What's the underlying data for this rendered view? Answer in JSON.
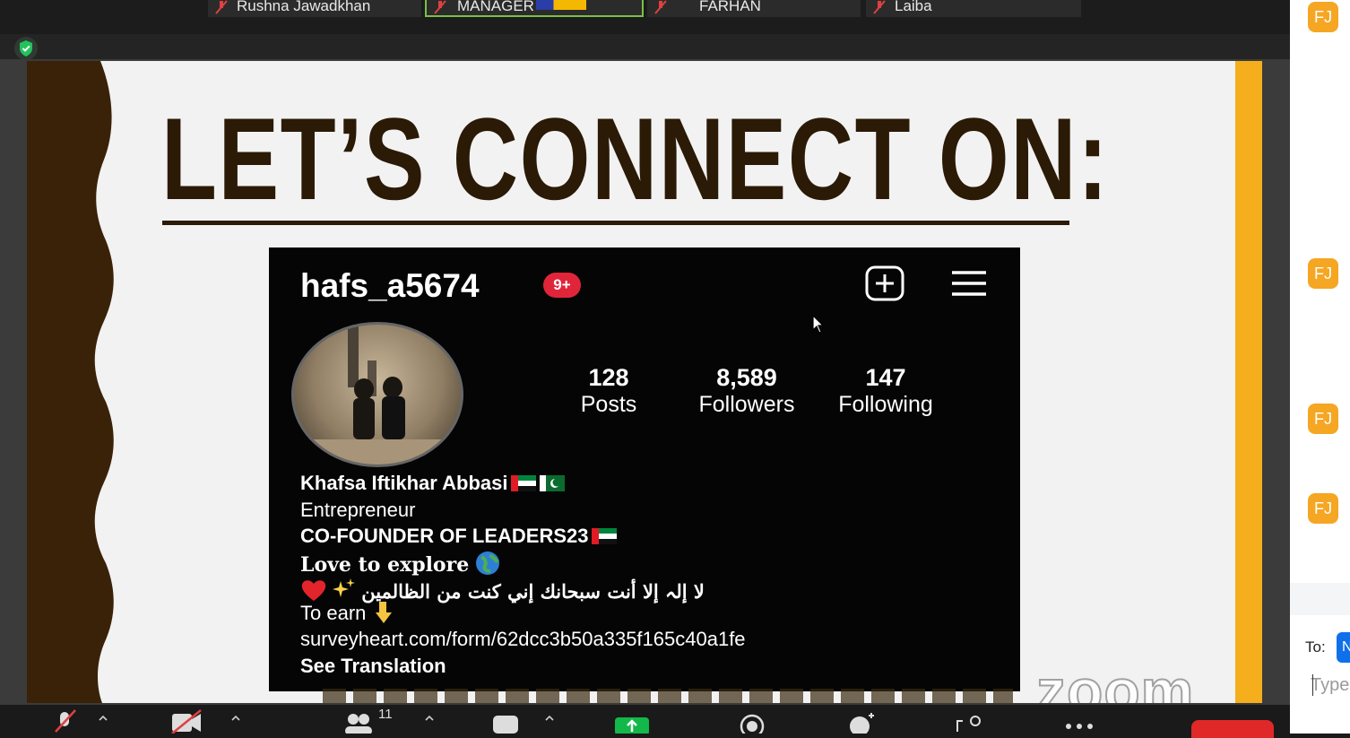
{
  "participants": [
    {
      "name": "Rushna Jawadkhan",
      "muted": true
    },
    {
      "name": "MANAGER",
      "muted": true,
      "active_speaker": true
    },
    {
      "name": "FARHAN",
      "muted": true
    },
    {
      "name": "Laiba",
      "muted": true
    }
  ],
  "slide": {
    "heading": "LET’S CONNECT ON:",
    "watermark": "zoom",
    "instagram": {
      "username": "hafs_a5674",
      "notifications": "9+",
      "stats": [
        {
          "value": "128",
          "label": "Posts"
        },
        {
          "value": "8,589",
          "label": "Followers"
        },
        {
          "value": "147",
          "label": "Following"
        }
      ],
      "bio": {
        "name": "Khafsa Iftikhar Abbasi",
        "role": "Entrepreneur",
        "line3": "CO-FOUNDER OF LEADERS23",
        "line4": "Love to explore",
        "arabic": "لا إلہ إلا أنت سبحانك إني كنت من الظالمين",
        "line6": "To earn",
        "link": "surveyheart.com/form/62dcc3b50a335f165c40a1fe",
        "translate": "See Translation"
      }
    }
  },
  "chat": {
    "avatars": [
      "FJ",
      "FJ",
      "FJ",
      "FJ"
    ],
    "to_label": "To:",
    "to_chip": "N",
    "input_placeholder": "Type"
  },
  "toolbar": {
    "participants_count": "11"
  },
  "colors": {
    "slide_brown": "#2b1a06",
    "slide_orange": "#f5ae1c",
    "avatar_orange": "#f5a623",
    "share_green": "#13b84a",
    "end_red": "#e02828",
    "notif_red": "#e0253a"
  }
}
